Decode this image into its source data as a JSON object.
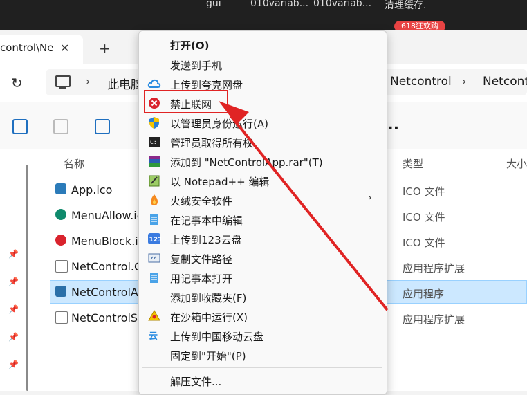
{
  "taskbar": {
    "items": [
      "gui",
      "010variab...",
      "010variab...",
      "清理缓存."
    ],
    "badge": "618狂欢购"
  },
  "tab": {
    "title": "control\\Ne",
    "close": "✕",
    "new": "+"
  },
  "address": {
    "crumbs": [
      "此电脑",
      "Netcontrol",
      "Netcontr"
    ],
    "sep": "›"
  },
  "toolbar": {
    "more": "..."
  },
  "columns": {
    "name": "名称",
    "type": "类型",
    "size": "大小"
  },
  "files": [
    {
      "name": "App.ico",
      "type": "ICO 文件"
    },
    {
      "name": "MenuAllow.ic",
      "type": "ICO 文件"
    },
    {
      "name": "MenuBlock.ic",
      "type": "ICO 文件"
    },
    {
      "name": "NetControl.C",
      "type": "应用程序扩展"
    },
    {
      "name": "NetControlAp",
      "type": "应用程序"
    },
    {
      "name": "NetControlSh",
      "type": "应用程序扩展"
    }
  ],
  "menu": {
    "open": "打开(O)",
    "send_phone": "发送到手机",
    "quark": "上传到夸克网盘",
    "block": "禁止联网",
    "run_admin": "以管理员身份运行(A)",
    "take_own": "管理员取得所有权",
    "add_rar": "添加到 \"NetControlApp.rar\"(T)",
    "notepadpp": "以 Notepad++ 编辑",
    "huorong": "火绒安全软件",
    "edit_notepad": "在记事本中编辑",
    "upload_123": "上传到123云盘",
    "copy_path": "复制文件路径",
    "open_notepad": "用记事本打开",
    "add_fav": "添加到收藏夹(F)",
    "sandbox": "在沙箱中运行(X)",
    "cmcc": "上传到中国移动云盘",
    "pin_start": "固定到\"开始\"(P)",
    "extract": "解压文件...",
    "submenu_arrow": "›"
  },
  "colors": {
    "highlight": "#e02424",
    "selection": "#cce8ff"
  }
}
